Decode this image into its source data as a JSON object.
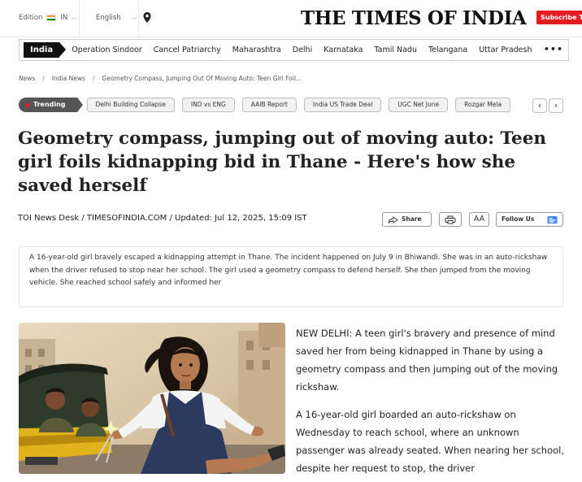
{
  "header": {
    "edition_label": "Edition",
    "edition_code": "IN",
    "language": "English",
    "logo": "THE TIMES OF INDIA",
    "subscribe": "Subscribe To"
  },
  "nav": {
    "home": "India",
    "items": [
      "Operation Sindoor",
      "Cancel Patriarchy",
      "Maharashtra",
      "Delhi",
      "Karnataka",
      "Tamil Nadu",
      "Telangana",
      "Uttar Pradesh"
    ],
    "more": "•••"
  },
  "breadcrumb": [
    "News",
    "India News",
    "Geometry Compass, Jumping Out Of Moving Auto: Teen Girl Foil..."
  ],
  "trending": {
    "label": "Trending",
    "chips": [
      "Delhi Building Collapse",
      "IND vs ENG",
      "AAIB Report",
      "India US Trade Deal",
      "UGC Net June",
      "Rozgar Mela"
    ]
  },
  "article": {
    "headline": "Geometry compass, jumping out of moving auto: Teen girl foils kidnapping bid in Thane - Here's how she saved herself",
    "byline": "TOI News Desk / TIMESOFINDIA.COM / Updated: Jul 12, 2025, 15:09 IST",
    "share": "Share",
    "font_size_label": "AA",
    "follow": "Follow Us",
    "summary": "A 16-year-old girl bravely escaped a kidnapping attempt in Thane. The incident happened on July 9 in Bhiwandi. She was in an auto-rickshaw when the driver refused to stop near her school. The girl used a geometry compass to defend herself. She then jumped from the moving vehicle. She reached school safely and informed her",
    "paragraphs": [
      "NEW DELHI: A teen girl's bravery and presence of mind saved her from being kidnapped in Thane by using a geometry compass and then jumping out of the moving rickshaw.",
      "A 16-year-old girl boarded an auto-rickshaw on Wednesday to reach school, where an unknown passenger was already seated. When nearing her school, despite her request to stop, the driver"
    ]
  },
  "colors": {
    "brand_red": "#e21b22",
    "nav_dark": "#111111"
  }
}
